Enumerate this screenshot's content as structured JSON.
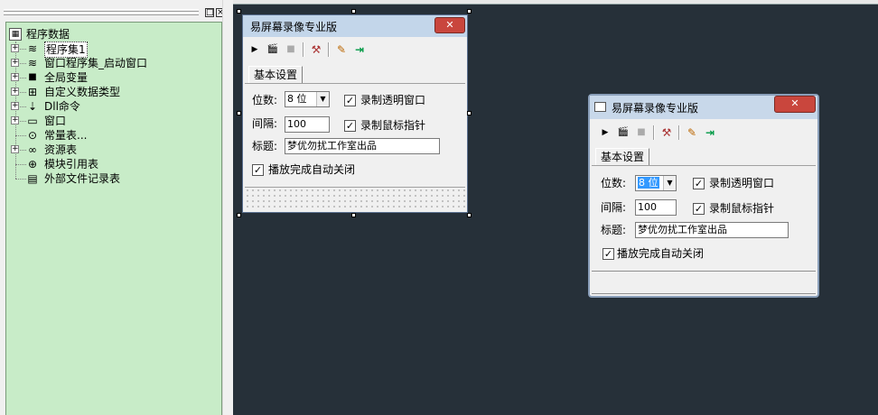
{
  "panel": {
    "max_btn": "□",
    "close_btn": "×"
  },
  "tree": {
    "root": "程序数据",
    "items": [
      {
        "label": "程序集1",
        "icon": "stack-icon",
        "glyph": "≋",
        "expander": "+"
      },
      {
        "label": "窗口程序集_启动窗口",
        "icon": "stack-icon",
        "glyph": "≋",
        "expander": "+"
      },
      {
        "label": "全局变量",
        "icon": "variable-icon",
        "glyph": "■",
        "expander": "+"
      },
      {
        "label": "自定义数据类型",
        "icon": "datatype-icon",
        "glyph": "⊞",
        "expander": "+"
      },
      {
        "label": "Dll命令",
        "icon": "dll-icon",
        "glyph": "⇣",
        "expander": "+"
      },
      {
        "label": "窗口",
        "icon": "window-icon",
        "glyph": "▭",
        "expander": "+"
      },
      {
        "label": "常量表...",
        "icon": "constant-icon",
        "glyph": "⊙",
        "expander": ""
      },
      {
        "label": "资源表",
        "icon": "resource-icon",
        "glyph": "∞",
        "expander": "+"
      },
      {
        "label": "模块引用表",
        "icon": "module-icon",
        "glyph": "⊕",
        "expander": ""
      },
      {
        "label": "外部文件记录表",
        "icon": "file-icon",
        "glyph": "▤",
        "expander": ""
      }
    ]
  },
  "design_form": {
    "title": "易屏幕录像专业版",
    "close": "✕",
    "tab": "基本设置",
    "bits_label": "位数:",
    "bits_value": "8 位",
    "interval_label": "间隔:",
    "interval_value": "100",
    "title_label": "标题:",
    "title_value": "梦优勿扰工作室出品",
    "chk_transparent": "录制透明窗口",
    "chk_pointer": "录制鼠标指针",
    "chk_autoclose": "播放完成自动关闭",
    "check_mark": "✓"
  },
  "run_form": {
    "title": "易屏幕录像专业版",
    "close": "✕",
    "tab": "基本设置",
    "bits_label": "位数:",
    "bits_value": "8 位",
    "interval_label": "间隔:",
    "interval_value": "100",
    "title_label": "标题:",
    "title_value": "梦优勿扰工作室出品",
    "chk_transparent": "录制透明窗口",
    "chk_pointer": "录制鼠标指针",
    "chk_autoclose": "播放完成自动关闭",
    "check_mark": "✓"
  },
  "toolbar_glyphs": {
    "play": "▶",
    "record": "🎬",
    "stop": "■",
    "tools": "⚒",
    "edit": "✎",
    "exit": "⇥",
    "arrow": "▼"
  },
  "colors": {
    "tree_bg": "#c8ecc8",
    "canvas_bg": "#263039",
    "close_red": "#c9463d",
    "selection": "#3399ff"
  }
}
